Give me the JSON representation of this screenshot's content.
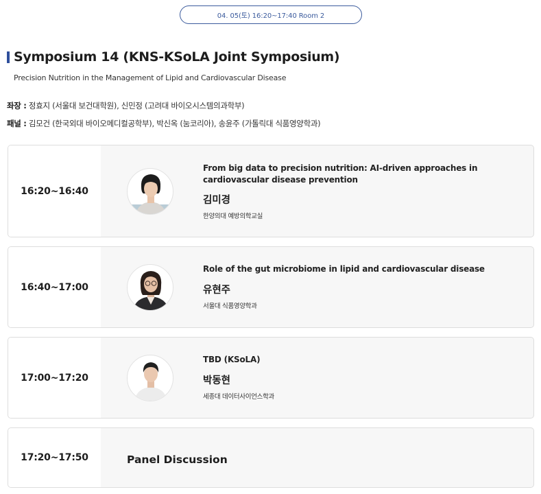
{
  "header": {
    "date_label": "04. 05(토) 16:20~17:40 Room 2"
  },
  "symposium": {
    "title": "Symposium 14 (KNS-KSoLA Joint Symposium)",
    "subtitle": "Precision Nutrition in the Management of Lipid and Cardiovascular Disease",
    "chair_label": "좌장 :",
    "chairs": "정효지 (서울대 보건대학원), 신민정 (고려대 바이오시스템의과학부)",
    "panel_label": "패널 :",
    "panelists": "김모건 (한국외대 바이오메디컬공학부), 박신옥 (눔코리아), 송윤주 (가톨릭대 식품영양학과)"
  },
  "sessions": [
    {
      "time": "16:20~16:40",
      "title": "From big data to precision nutrition: AI-driven approaches in cardiovascular disease prevention",
      "speaker": "김미경",
      "affiliation": "한양의대 예방의학교실"
    },
    {
      "time": "16:40~17:00",
      "title": "Role of the gut microbiome in lipid and cardiovascular disease",
      "speaker": "유현주",
      "affiliation": "서울대 식품영양학과"
    },
    {
      "time": "17:00~17:20",
      "title": "TBD (KSoLA)",
      "speaker": "박동현",
      "affiliation": "세종대 데이터사이언스학과"
    },
    {
      "time": "17:20~17:50",
      "title": "Panel Discussion"
    }
  ],
  "colors": {
    "accent": "#2f4f9c",
    "card_bg": "#f7f7f7",
    "card_border": "#dddddd"
  }
}
